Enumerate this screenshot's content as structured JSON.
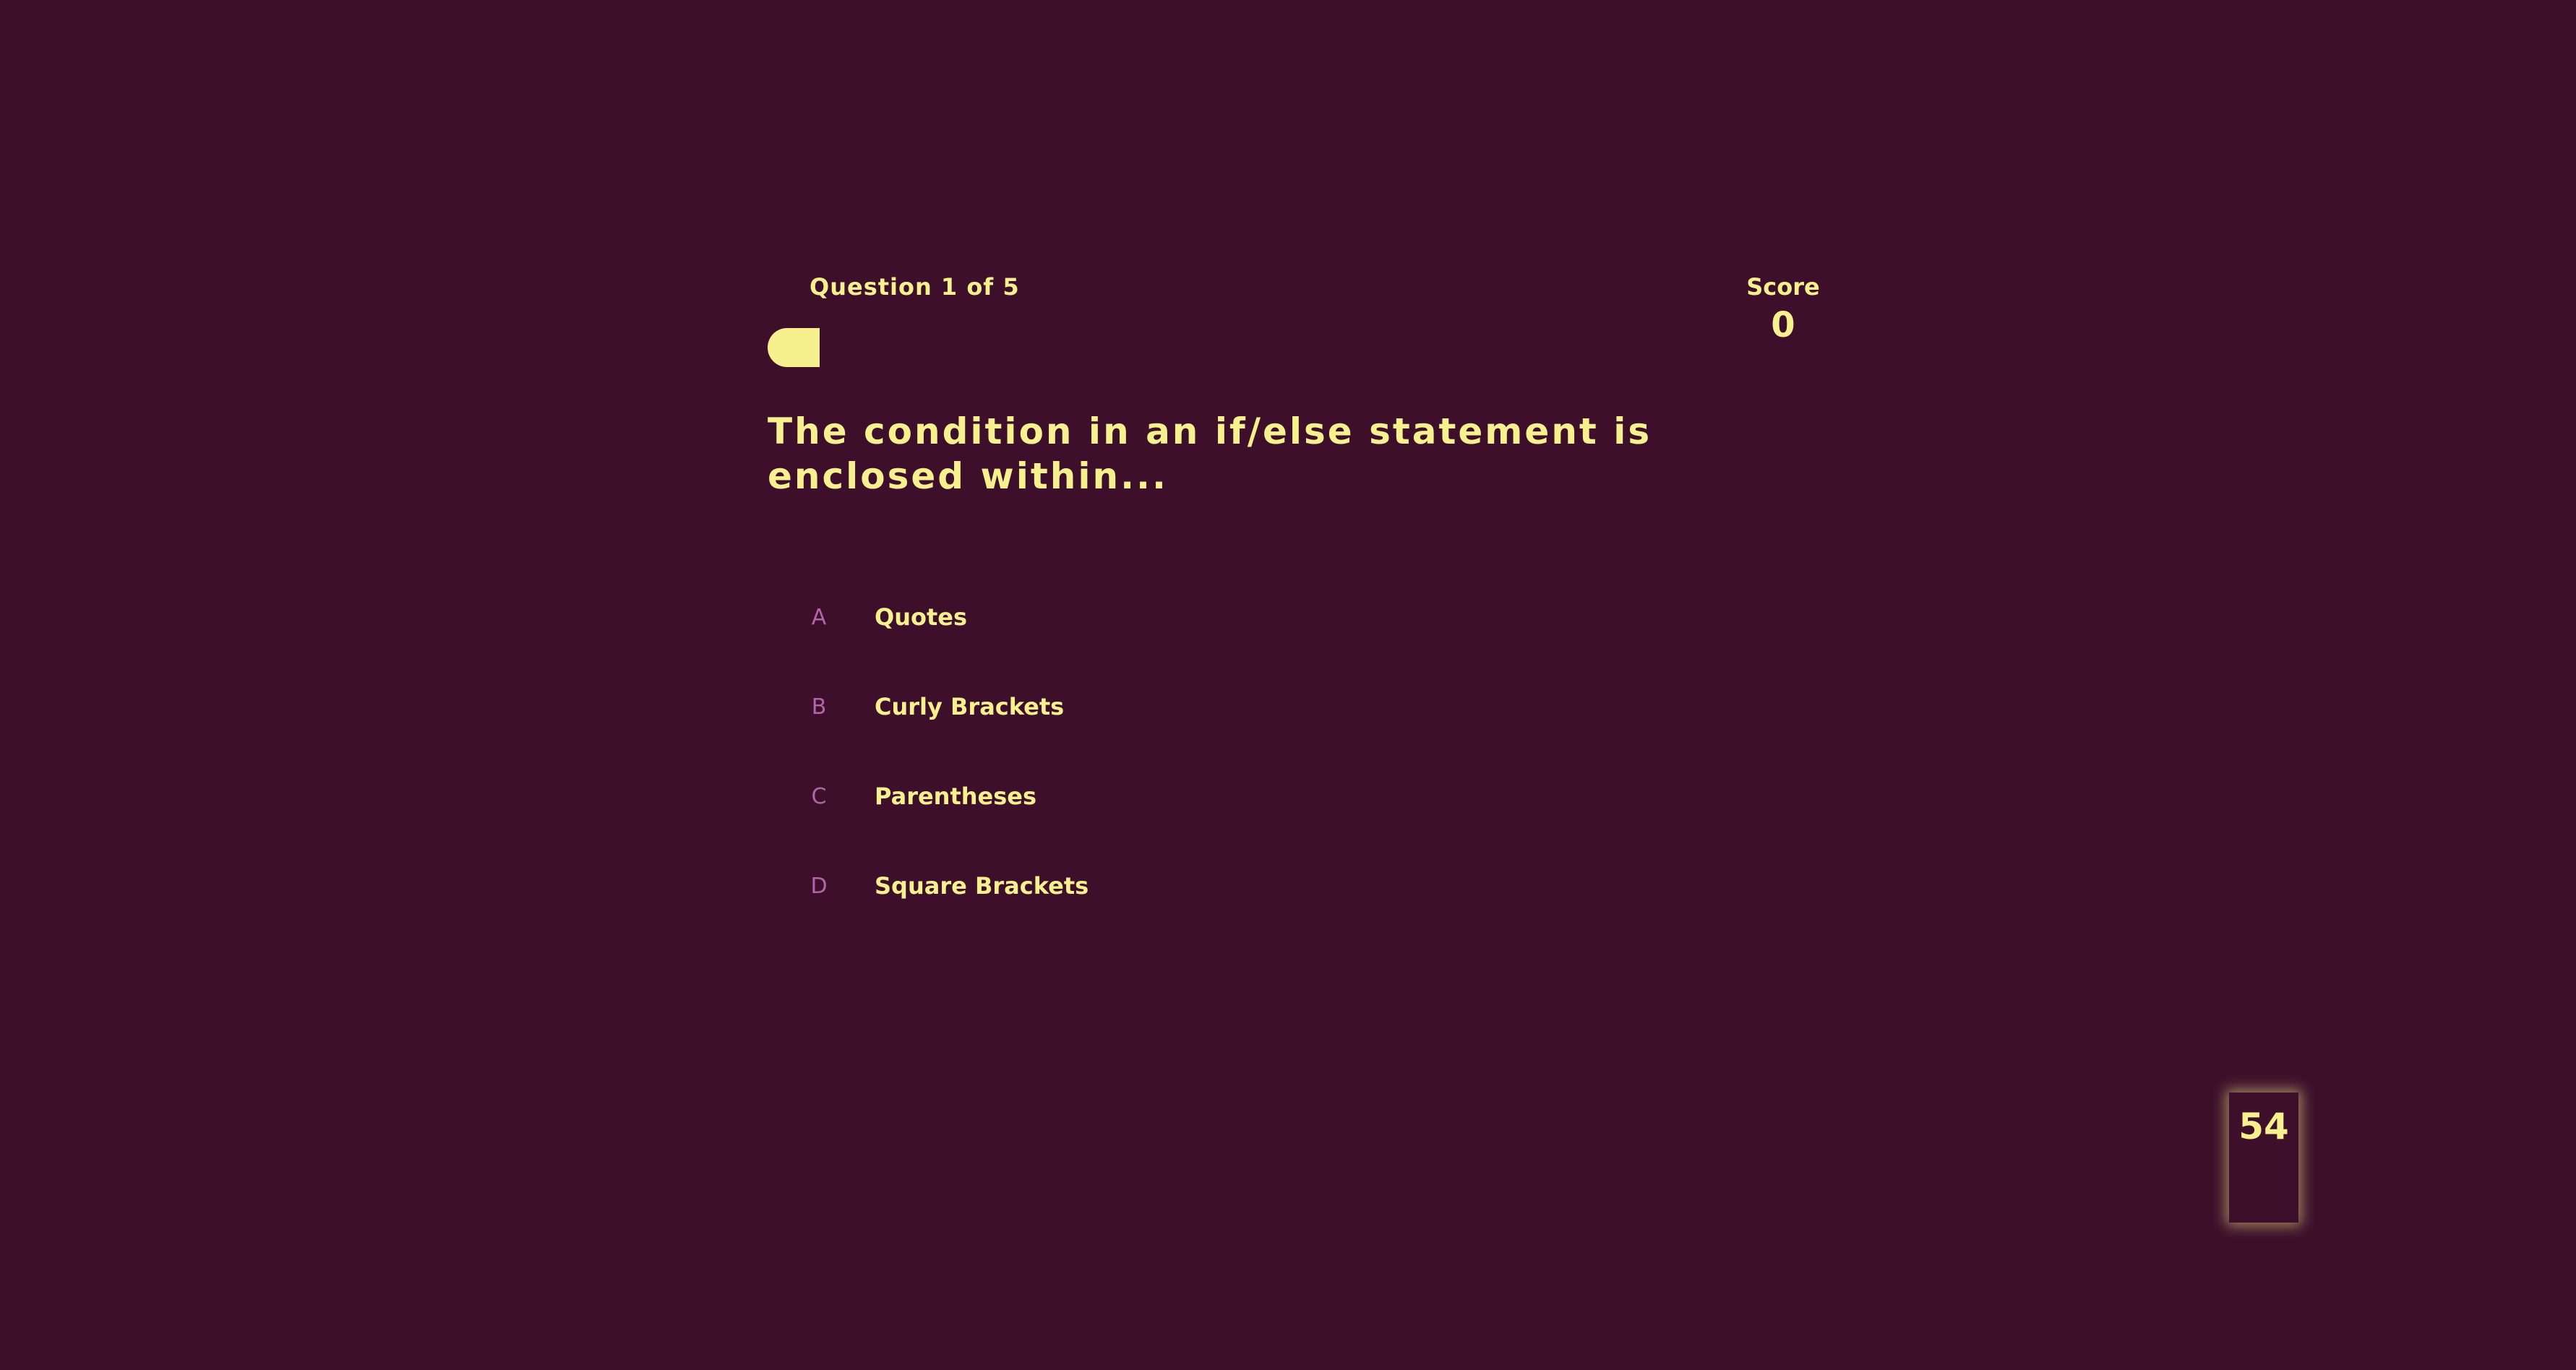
{
  "quiz": {
    "counter": "Question 1 of 5",
    "progress_fraction": 0.2,
    "question": "The condition in an if/else statement is enclosed within...",
    "answers": [
      {
        "letter": "A",
        "text": "Quotes"
      },
      {
        "letter": "B",
        "text": "Curly Brackets"
      },
      {
        "letter": "C",
        "text": "Parentheses"
      },
      {
        "letter": "D",
        "text": "Square Brackets"
      }
    ]
  },
  "score": {
    "label": "Score",
    "value": "0"
  },
  "timer": {
    "value": "54"
  },
  "colors": {
    "background": "#3d0f2a",
    "accent": "#f6f08e",
    "letter": "#b066a8"
  }
}
